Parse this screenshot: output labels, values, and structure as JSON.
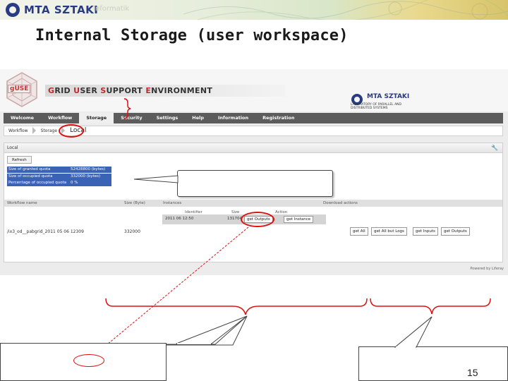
{
  "banner": {
    "brand": "MTA SZTAKI",
    "watermark": "Informatik"
  },
  "title": "Internal Storage (user workspace)",
  "portal": {
    "header": {
      "guse_mark": "gUSE",
      "name_parts": [
        "G",
        "RID ",
        "U",
        "SER ",
        "S",
        "UPPORT ",
        "E",
        "NVIRONMENT"
      ],
      "sztaki_name": "MTA SZTAKI",
      "sztaki_sub": "LABORATORY OF PARALLEL AND DISTRIBUTED SYSTEMS"
    },
    "nav": [
      "Welcome",
      "Workflow",
      "Storage",
      "Security",
      "Settings",
      "Help",
      "Information",
      "Registration"
    ],
    "nav_active": "Storage",
    "breadcrumb": [
      "Workflow",
      "Storage",
      "Local"
    ],
    "panel_title": "Local",
    "refresh_label": "Refresh",
    "quota": [
      {
        "label": "Size of granted quota",
        "value": "52428800 (bytes)"
      },
      {
        "label": "Size of occupied quota",
        "value": "332000 (bytes)"
      },
      {
        "label": "Percentage of occupied quota",
        "value": "0 %"
      }
    ],
    "table_headers": [
      "Workflow name",
      "Size (Byte)",
      "Instances",
      "Download actions"
    ],
    "inner_headers": [
      "Identifier",
      "Size",
      "Action"
    ],
    "instance": {
      "id": "2011 06 12:50",
      "size": "131704",
      "btn_outputs": "get Outputs",
      "btn_instance": "get Instance"
    },
    "job": {
      "name": "/ix3_od__pabgrid_2011 05 06 12309",
      "size": "332000"
    },
    "job_buttons": [
      "get All",
      "get All but Logs",
      "get Inputs",
      "get Outputs"
    ],
    "powered_by": "Powered by Liferay"
  },
  "page_number": "15"
}
